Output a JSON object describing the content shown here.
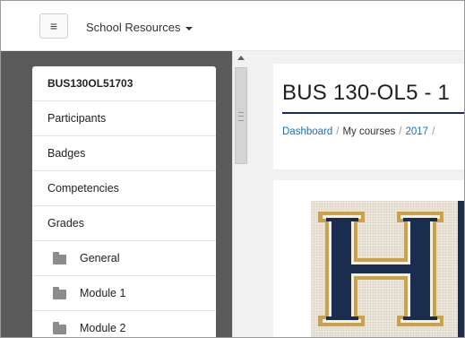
{
  "navbar": {
    "menu_icon": "hamburger-menu-icon",
    "school_resources_label": "School Resources"
  },
  "drawer": {
    "course_code": "BUS130OL51703",
    "items": [
      {
        "label": "Participants"
      },
      {
        "label": "Badges"
      },
      {
        "label": "Competencies"
      },
      {
        "label": "Grades"
      }
    ],
    "sections": [
      {
        "label": "General",
        "icon": "folder-icon"
      },
      {
        "label": "Module 1",
        "icon": "folder-icon"
      },
      {
        "label": "Module 2",
        "icon": "folder-icon"
      }
    ]
  },
  "header": {
    "title": "BUS 130-OL5 - 1",
    "breadcrumb": {
      "dashboard": "Dashboard",
      "my_courses": "My courses",
      "year": "2017",
      "separator": "/"
    }
  },
  "colors": {
    "drawer_bg": "#5a5a5a",
    "link": "#1a6fb3",
    "title_rule": "#1a2a5a",
    "logo_navy": "#1b2d4f",
    "logo_gold": "#c9a24a"
  }
}
